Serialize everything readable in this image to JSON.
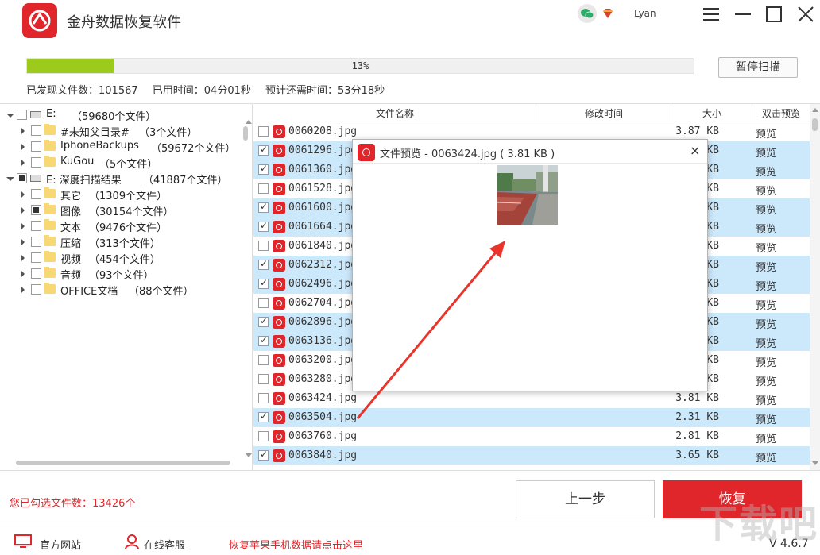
{
  "app": {
    "title": "金舟数据恢复软件",
    "user": "Lyan",
    "accent": "#e0262b"
  },
  "scan": {
    "progress_percent": 13,
    "progress_label": "13%",
    "pause_label": "暂停扫描",
    "found_files": "已发现文件数：101567",
    "elapsed": "已用时间：04分01秒",
    "remaining": "预计还需时间：53分18秒"
  },
  "tree": [
    {
      "label": "E:",
      "count": "（59680个文件）",
      "level": 0,
      "icon": "drive-icon",
      "expanded": true,
      "check": "none"
    },
    {
      "label": "#未知父目录#",
      "count": "（3个文件）",
      "level": 1,
      "icon": "folder-icon",
      "expanded": false,
      "check": "none"
    },
    {
      "label": "IphoneBackups",
      "count": "（59672个文件）",
      "level": 1,
      "icon": "folder-icon",
      "expanded": false,
      "check": "none"
    },
    {
      "label": "KuGou",
      "count": "（5个文件）",
      "level": 1,
      "icon": "folder-icon",
      "expanded": false,
      "check": "none"
    },
    {
      "label": "E:  深度扫描结果",
      "count": "（41887个文件）",
      "level": 0,
      "icon": "drive-icon",
      "expanded": true,
      "check": "partial"
    },
    {
      "label": "其它",
      "count": "（1309个文件）",
      "level": 1,
      "icon": "folder-icon",
      "expanded": false,
      "check": "none"
    },
    {
      "label": "图像",
      "count": "（30154个文件）",
      "level": 1,
      "icon": "folder-icon",
      "expanded": false,
      "check": "partial"
    },
    {
      "label": "文本",
      "count": "（9476个文件）",
      "level": 1,
      "icon": "folder-icon",
      "expanded": false,
      "check": "none"
    },
    {
      "label": "压缩",
      "count": "（313个文件）",
      "level": 1,
      "icon": "folder-icon",
      "expanded": false,
      "check": "none"
    },
    {
      "label": "视频",
      "count": "（454个文件）",
      "level": 1,
      "icon": "folder-icon",
      "expanded": false,
      "check": "none"
    },
    {
      "label": "音频",
      "count": "（93个文件）",
      "level": 1,
      "icon": "folder-icon",
      "expanded": false,
      "check": "none"
    },
    {
      "label": "OFFICE文档",
      "count": "（88个文件）",
      "level": 1,
      "icon": "folder-icon",
      "expanded": false,
      "check": "none"
    }
  ],
  "table": {
    "columns": [
      "文件名称",
      "修改时间",
      "大小",
      "双击预览"
    ],
    "rows": [
      {
        "name": "0060208.jpg",
        "size": "3.87 KB",
        "preview": "预览",
        "checked": false
      },
      {
        "name": "0061296.jpg",
        "size": "KB",
        "preview": "预览",
        "checked": true
      },
      {
        "name": "0061360.jpg",
        "size": "KB",
        "preview": "预览",
        "checked": true
      },
      {
        "name": "0061528.jpg",
        "size": "KB",
        "preview": "预览",
        "checked": false
      },
      {
        "name": "0061600.jpg",
        "size": "KB",
        "preview": "预览",
        "checked": true
      },
      {
        "name": "0061664.jpg",
        "size": "KB",
        "preview": "预览",
        "checked": true
      },
      {
        "name": "0061840.jpg",
        "size": "KB",
        "preview": "预览",
        "checked": false
      },
      {
        "name": "0062312.jpg",
        "size": "KB",
        "preview": "预览",
        "checked": true
      },
      {
        "name": "0062496.jpg",
        "size": "KB",
        "preview": "预览",
        "checked": true
      },
      {
        "name": "0062704.jpg",
        "size": "KB",
        "preview": "预览",
        "checked": false
      },
      {
        "name": "0062896.jpg",
        "size": "KB",
        "preview": "预览",
        "checked": true
      },
      {
        "name": "0063136.jpg",
        "size": "KB",
        "preview": "预览",
        "checked": true
      },
      {
        "name": "0063200.jpg",
        "size": "KB",
        "preview": "预览",
        "checked": false
      },
      {
        "name": "0063280.jpg",
        "size": "KB",
        "preview": "预览",
        "checked": false
      },
      {
        "name": "0063424.jpg",
        "size": "3.81 KB",
        "preview": "预览",
        "checked": false
      },
      {
        "name": "0063504.jpg",
        "size": "2.31 KB",
        "preview": "预览",
        "checked": true
      },
      {
        "name": "0063760.jpg",
        "size": "2.81 KB",
        "preview": "预览",
        "checked": false
      },
      {
        "name": "0063840.jpg",
        "size": "3.65 KB",
        "preview": "预览",
        "checked": true
      }
    ]
  },
  "dialog": {
    "title": "文件预览 - 0063424.jpg ( 3.81 KB )",
    "close": "×"
  },
  "bottom": {
    "selected": "您已勾选文件数：13426个",
    "back": "上一步",
    "recover": "恢复"
  },
  "footer": {
    "website": "官方网站",
    "service": "在线客服",
    "apple": "恢复苹果手机数据请点击这里",
    "version": "V 4.6.7"
  },
  "watermark": "下载吧"
}
